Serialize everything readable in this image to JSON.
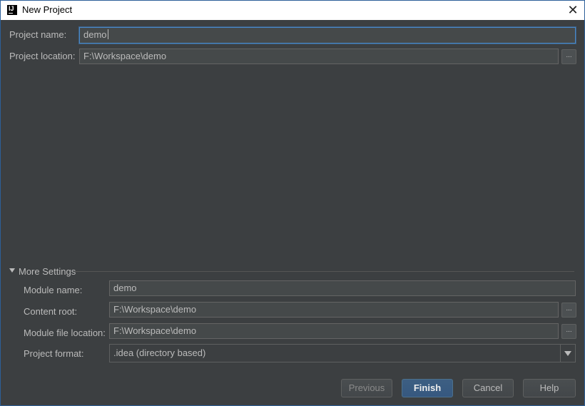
{
  "window": {
    "title": "New Project",
    "logo_text": "IJ"
  },
  "project": {
    "name_label": "Project name:",
    "name_value": "demo",
    "location_label": "Project location:",
    "location_value": "F:\\Workspace\\demo",
    "browse_label": "..."
  },
  "more_settings": {
    "label": "More Settings",
    "module_name_label": "Module name:",
    "module_name_value": "demo",
    "content_root_label": "Content root:",
    "content_root_value": "F:\\Workspace\\demo",
    "module_file_label": "Module file location:",
    "module_file_value": "F:\\Workspace\\demo",
    "format_label": "Project format:",
    "format_value": ".idea (directory based)"
  },
  "buttons": {
    "previous": "Previous",
    "finish": "Finish",
    "cancel": "Cancel",
    "help": "Help"
  },
  "colors": {
    "background": "#3c3f41",
    "field": "#45494a",
    "focus_border": "#4a88c7",
    "default_button": "#365880",
    "text": "#bbbbbb"
  },
  "icons": {
    "close": "close-icon",
    "expand": "triangle-down-icon",
    "dropdown": "chevron-down-icon"
  }
}
